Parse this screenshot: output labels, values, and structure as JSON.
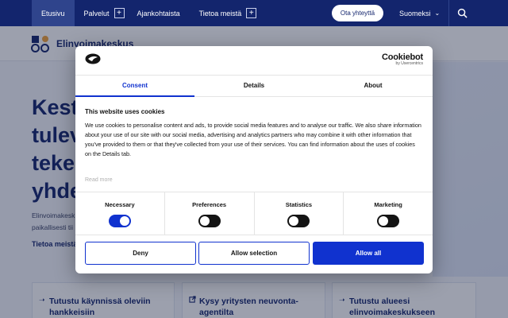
{
  "nav": {
    "items": [
      {
        "label": "Etusivu"
      },
      {
        "label": "Palvelut"
      },
      {
        "label": "Ajankohtaista"
      },
      {
        "label": "Tietoa meistä"
      }
    ],
    "expand_symbol": "+",
    "contact_label": "Ota yhteyttä",
    "language_label": "Suomeksi",
    "search_icon": "search-icon"
  },
  "header": {
    "site_name": "Elinvoimakeskus"
  },
  "hero": {
    "title_lines": [
      "Keste",
      "tulev",
      "teker",
      "yhde"
    ],
    "body_lines": [
      "Elinvoimakesk",
      "paikallisesti tii"
    ],
    "link_label": "Tietoa meistä"
  },
  "cards": [
    {
      "icon": "arrow-right-icon",
      "title_lines": [
        "Tutustu käynnissä oleviin",
        "hankkeisiin"
      ]
    },
    {
      "icon": "external-link-icon",
      "title_lines": [
        "Kysy yritysten neuvonta-",
        "agentilta"
      ]
    },
    {
      "icon": "arrow-right-icon",
      "title_lines": [
        "Tutustu alueesi",
        "elinvoimakeskukseen"
      ]
    }
  ],
  "cookie_dialog": {
    "brand": "Cookiebot",
    "brand_sub": "by Usercentrics",
    "tabs": [
      {
        "label": "Consent",
        "active": true
      },
      {
        "label": "Details",
        "active": false
      },
      {
        "label": "About",
        "active": false
      }
    ],
    "title": "This website uses cookies",
    "body": "We use cookies to personalise content and ads, to provide social media features and to analyse our traffic. We also share information about your use of our site with our social media, advertising and analytics partners who may combine it with other information that you've provided to them or that they've collected from your use of their services. You can find information about the uses of cookies on the Details tab.",
    "read_more": "Read more",
    "toggles": [
      {
        "label": "Necessary",
        "on": true
      },
      {
        "label": "Preferences",
        "on": false
      },
      {
        "label": "Statistics",
        "on": false
      },
      {
        "label": "Marketing",
        "on": false
      }
    ],
    "buttons": {
      "deny": "Deny",
      "allow_selection": "Allow selection",
      "allow_all": "Allow all"
    }
  },
  "colors": {
    "nav_bg": "#13256d",
    "accent_blue": "#1032cf"
  }
}
